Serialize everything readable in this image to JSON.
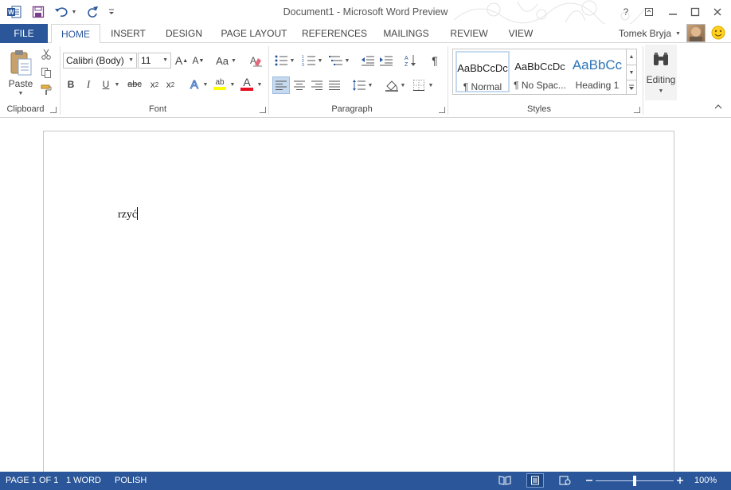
{
  "window": {
    "title": "Document1 - Microsoft Word Preview"
  },
  "quick_access": {
    "app_icon": "word-icon",
    "save_icon": "save-icon",
    "undo_icon": "undo-icon",
    "redo_icon": "redo-icon",
    "customize_icon": "customize-qat-icon"
  },
  "window_controls": {
    "help": "?",
    "ribbon_options": "restore-ribbon-icon",
    "minimize": "minimize-icon",
    "maximize": "maximize-icon",
    "close": "close-icon"
  },
  "tabs": {
    "file": "FILE",
    "items": [
      "HOME",
      "INSERT",
      "DESIGN",
      "PAGE LAYOUT",
      "REFERENCES",
      "MAILINGS",
      "REVIEW",
      "VIEW"
    ],
    "active": "HOME"
  },
  "user": {
    "name": "Tomek Bryja",
    "feedback_icon": "smiley-icon"
  },
  "ribbon": {
    "clipboard": {
      "label": "Clipboard",
      "paste": "Paste",
      "cut_icon": "scissors-icon",
      "copy_icon": "copy-icon",
      "format_painter_icon": "format-painter-icon"
    },
    "font": {
      "label": "Font",
      "font_name": "Calibri (Body)",
      "font_size": "11",
      "grow_font": "A",
      "shrink_font": "A",
      "change_case": "Aa",
      "bold": "B",
      "italic": "I",
      "underline": "U",
      "strikethrough": "abc",
      "subscript": "x",
      "superscript": "x",
      "subscript_mark": "2",
      "superscript_mark": "2",
      "text_effects": "A",
      "highlight": "ab",
      "font_color": "A"
    },
    "paragraph": {
      "label": "Paragraph",
      "show_marks": "¶"
    },
    "styles": {
      "label": "Styles",
      "items": [
        {
          "sample": "AaBbCcDc",
          "name": "¶ Normal"
        },
        {
          "sample": "AaBbCcDc",
          "name": "¶ No Spac..."
        },
        {
          "sample": "AaBbCc",
          "name": "Heading 1"
        }
      ]
    },
    "editing": {
      "label": "Editing"
    }
  },
  "document": {
    "text": "rzyć"
  },
  "status_bar": {
    "page": "PAGE 1 OF 1",
    "words": "1 WORD",
    "language": "POLISH",
    "zoom": "100%",
    "zoom_level": 0.5
  },
  "colors": {
    "accent": "#2b579a",
    "highlight_yellow": "#ffff00",
    "font_color_red": "#e81123",
    "heading_blue": "#2e74b5"
  }
}
